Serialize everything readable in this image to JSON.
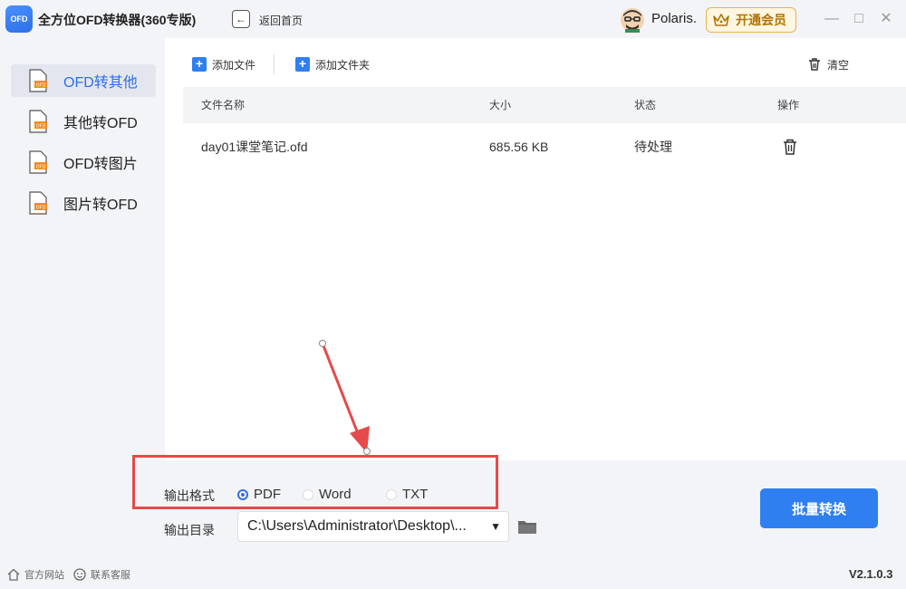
{
  "app": {
    "logo_text": "OFD",
    "title": "全方位OFD转换器(360专版)",
    "back_label": "返回首页",
    "username": "Polaris.",
    "vip_label": "开通会员",
    "version": "V2.1.0.3"
  },
  "sidebar": {
    "items": [
      {
        "label": "OFD转其他",
        "active": true
      },
      {
        "label": "其他转OFD",
        "active": false
      },
      {
        "label": "OFD转图片",
        "active": false
      },
      {
        "label": "图片转OFD",
        "active": false
      }
    ]
  },
  "toolbar": {
    "add_file": "添加文件",
    "add_folder": "添加文件夹",
    "clear": "清空"
  },
  "table": {
    "headers": [
      "文件名称",
      "大小",
      "状态",
      "操作"
    ],
    "rows": [
      {
        "name": "day01课堂笔记.ofd",
        "size": "685.56 KB",
        "status": "待处理"
      }
    ]
  },
  "output": {
    "format_label": "输出格式",
    "formats": [
      "PDF",
      "Word",
      "TXT"
    ],
    "selected_format": "PDF",
    "dir_label": "输出目录",
    "dir_value": "C:\\Users\\Administrator\\Desktop\\...",
    "convert_button": "批量转换"
  },
  "footer": {
    "website": "官方网站",
    "support": "联系客服"
  },
  "colors": {
    "accent": "#2f7ff0",
    "annotation": "#e64a4a",
    "vip": "#e6b34a"
  }
}
